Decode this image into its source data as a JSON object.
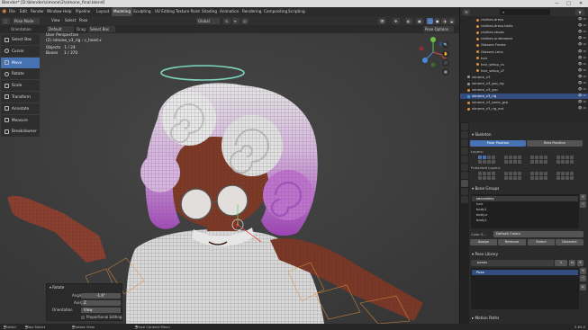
{
  "window": {
    "title": "Blender* [D:\\blender\\simone\\2\\simone_final.blend]",
    "controls": [
      "—",
      "□",
      "✕"
    ]
  },
  "menu": {
    "items": [
      "File",
      "Edit",
      "Render",
      "Window",
      "Help",
      "Pipeline"
    ],
    "workspaces": [
      "Layout",
      "Modeling",
      "Sculpting",
      "UV Editing",
      "Texture Paint",
      "Shading",
      "Animation",
      "Rendering",
      "Compositing",
      "Scripting"
    ],
    "active_workspace": "Modeling",
    "scene_label": "Scene",
    "view_layer": "character"
  },
  "header3d": {
    "mode": "Pose Mode",
    "menus": [
      "View",
      "Select",
      "Pose"
    ],
    "transform_orientation": "Global"
  },
  "tool_header": {
    "orientation_label": "Orientation:",
    "orientation_value": "Default",
    "drag_label": "Drag:",
    "drag_value": "Select Box",
    "pose_options": "Pose Options"
  },
  "toolbar": {
    "tools": [
      "Select Box",
      "Cursor",
      "Move",
      "Rotate",
      "Scale",
      "Transform",
      "Annotate",
      "Measure",
      "Breakdowner"
    ],
    "active": "Move"
  },
  "viewport": {
    "view_name": "User Perspective",
    "object_line": "(2) simone_v3_rig : c_head.x",
    "objects_label": "Objects",
    "objects_value": "1 / 24",
    "bones_label": "Bones",
    "bones_value": "1 / 370",
    "nav": [
      "🔍",
      "✋",
      "🎥",
      "▦"
    ]
  },
  "rotate_panel": {
    "title": "Rotate",
    "angle_label": "Angle",
    "angle_value": "-1.6°",
    "axis_label": "Axis",
    "axis_value": "Z",
    "orientation_label": "Orientation",
    "orientation_value": "View",
    "proportional_label": "Proportional Editing"
  },
  "outliner": {
    "search_placeholder": "",
    "rows": [
      {
        "name": "clothes.dress",
        "color": "#e0913a",
        "selected": false
      },
      {
        "name": "clothes.dress.belts",
        "color": "#e0913a",
        "selected": false
      },
      {
        "name": "clothes.shoes",
        "color": "#e0913a",
        "selected": false
      },
      {
        "name": "clothes.underwear",
        "color": "#e0913a",
        "selected": false
      },
      {
        "name": "Glasses Frame",
        "color": "#e0913a",
        "selected": false
      },
      {
        "name": "Glasses Lens",
        "color": "#e0913a",
        "selected": false
      },
      {
        "name": "hair",
        "color": "#e0913a",
        "selected": false
      },
      {
        "name": "hair_setup_cs",
        "color": "#e0913a",
        "selected": false
      },
      {
        "name": "hair_setup_LF",
        "color": "#e0913a",
        "selected": false
      },
      {
        "name": "simone_v3",
        "color": "#9a9a9a",
        "selected": false
      },
      {
        "name": "simone_v3_grp_rig",
        "color": "#9a9a9a",
        "selected": false
      },
      {
        "name": "simone_v3_grp",
        "color": "#e0913a",
        "selected": false
      },
      {
        "name": "simone_v3_rig",
        "color": "#4aa3d8",
        "selected": true
      },
      {
        "name": "simone_v3_bone_grp",
        "color": "#e0913a",
        "selected": false
      },
      {
        "name": "simone_v3_rig_ext",
        "color": "#e0913a",
        "selected": false
      }
    ]
  },
  "properties": {
    "skeleton_title": "Skeleton",
    "pose_position": "Pose Position",
    "rest_position": "Rest Position",
    "layers_label": "Layers:",
    "protected_layers_label": "Protected Layers:",
    "bone_groups_title": "Bone Groups",
    "bone_groups": [
      "secondary",
      "hair",
      "body1",
      "body.x",
      "body1"
    ],
    "color_set_label": "Color S...",
    "color_set_value": "Default Colors",
    "group_buttons": [
      "Assign",
      "Remove",
      "Select",
      "Deselect"
    ],
    "pose_library_title": "Pose Library",
    "pose_library_name": "poses",
    "pose_library_count": "1",
    "pose_entry": "Pose",
    "motion_paths_title": "Motion Paths"
  },
  "statusbar": {
    "items": [
      "Select",
      "Box Select",
      "Rotate View",
      "Pose Context Menu"
    ],
    "version": "2.83.0"
  }
}
